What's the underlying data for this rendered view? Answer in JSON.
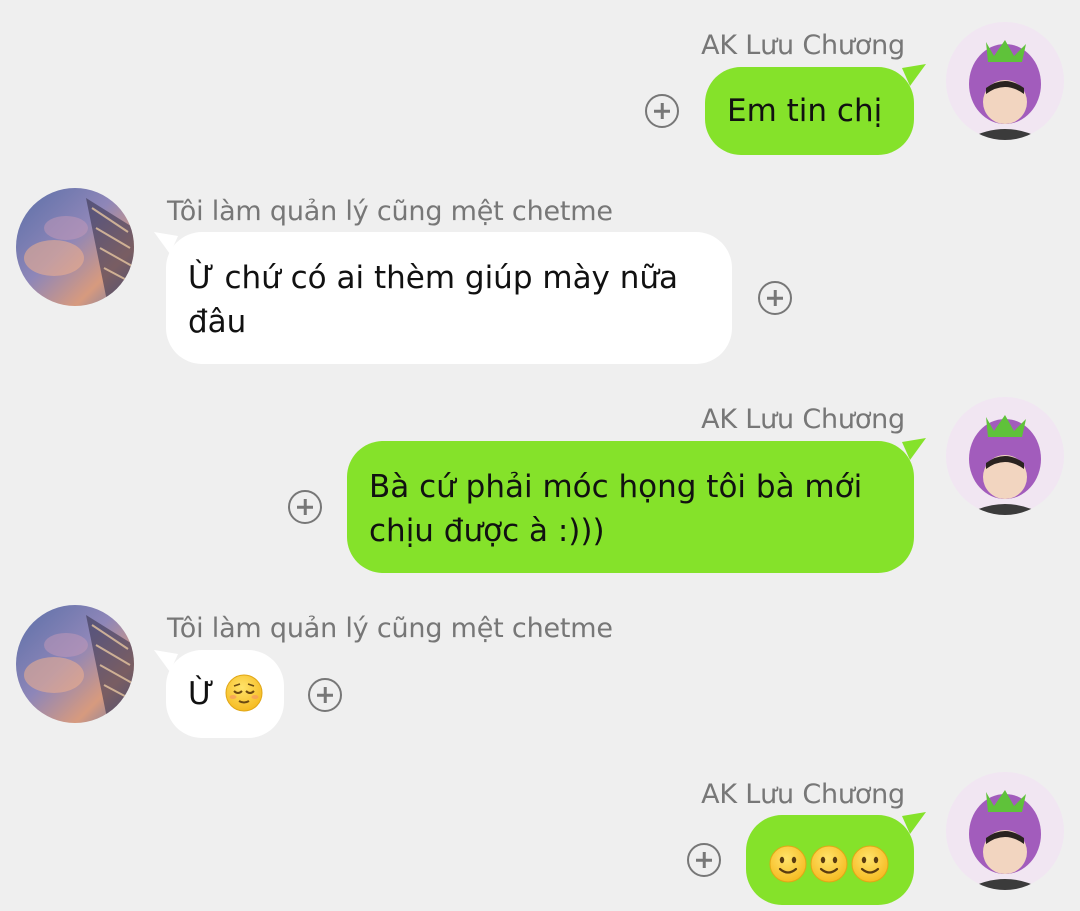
{
  "contacts": {
    "me": {
      "name": "AK Lưu Chương"
    },
    "other": {
      "name": "Tôi làm quản lý cũng mệt chetme"
    }
  },
  "messages": [
    {
      "sender": "me",
      "sender_name": "AK Lưu Chương",
      "text": "Em tin chị"
    },
    {
      "sender": "other",
      "sender_name": "Tôi làm quản lý cũng mệt chetme",
      "lines": [
        "Ừ chứ có ai thèm giúp mày nữa",
        "đâu"
      ]
    },
    {
      "sender": "me",
      "sender_name": "AK Lưu Chương",
      "lines": [
        "Bà cứ phải móc họng tôi bà mới",
        "chịu được à :)))"
      ]
    },
    {
      "sender": "other",
      "sender_name": "Tôi làm quản lý cũng mệt chetme",
      "text": "Ừ",
      "emoji": "relieved-face"
    },
    {
      "sender": "me",
      "sender_name": "AK Lưu Chương",
      "emoji": [
        "slightly-smiling-face",
        "slightly-smiling-face",
        "slightly-smiling-face"
      ]
    }
  ],
  "colors": {
    "background": "#efefef",
    "outgoing_bubble": "#85e22a",
    "incoming_bubble": "#ffffff",
    "secondary_text": "#777777"
  },
  "icons": {
    "reaction": "add-reaction-icon",
    "my_avatar": "eggplant-hat-avatar",
    "other_avatar": "sky-building-avatar"
  }
}
